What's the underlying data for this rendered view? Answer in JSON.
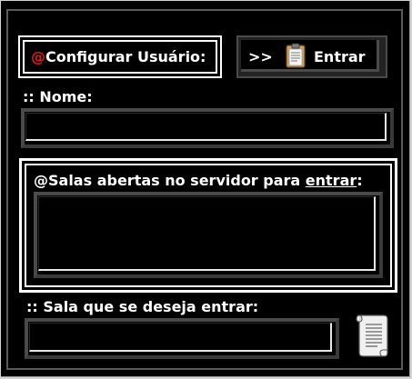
{
  "config": {
    "prefix": "@",
    "label": "Configurar Usuário:"
  },
  "enter_button": {
    "arrows": ">>",
    "label": "Entrar",
    "icon": "clipboard-icon"
  },
  "name_field": {
    "label": ":: Nome:",
    "value": ""
  },
  "rooms_panel": {
    "title_before": "@Salas abertas no servidor para ",
    "title_link": "entrar",
    "title_after": ":",
    "rooms": []
  },
  "room_field": {
    "label": ":: Sala que se deseja entrar:",
    "value": "",
    "icon": "scroll-icon"
  },
  "colors": {
    "background": "#000000",
    "text": "#ffffff",
    "accent": "#e01818",
    "border": "#4a4a4a"
  }
}
